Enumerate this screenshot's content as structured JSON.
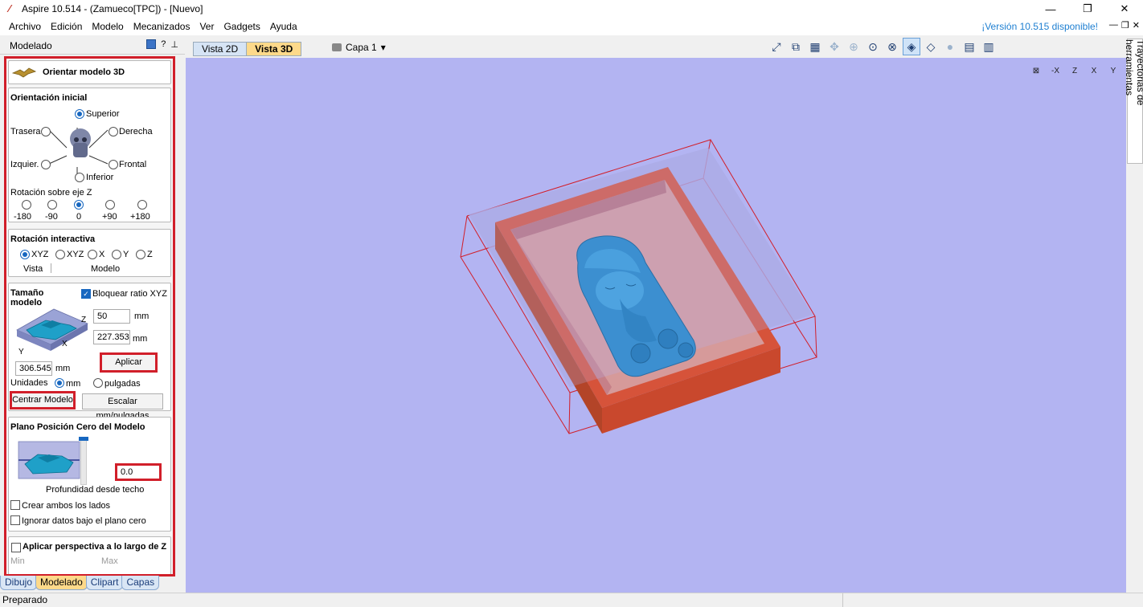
{
  "window": {
    "title": "Aspire 10.514 - (Zamueco[TPC]) - [Nuevo]"
  },
  "menu": {
    "items": [
      "Archivo",
      "Edición",
      "Modelo",
      "Mecanizados",
      "Ver",
      "Gadgets",
      "Ayuda"
    ],
    "version_link": "¡Versión 10.515 disponible!"
  },
  "left_header": {
    "title": "Modelado",
    "help": "?"
  },
  "panel": {
    "title": "Orientar modelo 3D",
    "orientation": {
      "title": "Orientación inicial",
      "superior": "Superior",
      "trasera": "Trasera",
      "derecha": "Derecha",
      "izquierda": "Izquier.",
      "frontal": "Frontal",
      "inferior": "Inferior",
      "selected": "Superior"
    },
    "rotation_z": {
      "label": "Rotación sobre eje Z",
      "options": [
        "-180",
        "-90",
        "0",
        "+90",
        "+180"
      ],
      "selected": "0"
    },
    "interactive": {
      "title": "Rotación interactiva",
      "options": [
        "XYZ",
        "XYZ",
        "X",
        "Y",
        "Z"
      ],
      "selected": 0,
      "group_vista": "Vista",
      "group_modelo": "Modelo"
    },
    "size": {
      "title": "Tamaño modelo",
      "lock_label": "Bloquear ratio XYZ",
      "lock_checked": true,
      "z_value": "50",
      "y_value": "227.353",
      "x_value": "306.545",
      "unit": "mm",
      "axis_z": "Z",
      "axis_x": "X",
      "axis_y": "Y",
      "apply_button": "Aplicar",
      "units_label": "Unidades",
      "unit_mm": "mm",
      "unit_in": "pulgadas",
      "center_button": "Centrar Modelo",
      "scale_button": "Escalar mm/pulgadas"
    },
    "zero_plane": {
      "title": "Plano Posición Cero del Modelo",
      "value": "0.0",
      "depth_label": "Profundidad desde techo",
      "both_sides": "Crear ambos los lados",
      "ignore_below": "Ignorar datos bajo el plano cero"
    },
    "perspective": {
      "title": "Aplicar perspectiva a lo largo de Z",
      "min": "Min",
      "max": "Max"
    }
  },
  "bottom_tabs": [
    {
      "label": "Dibujo"
    },
    {
      "label": "Modelado",
      "active": true
    },
    {
      "label": "Clipart"
    },
    {
      "label": "Capas"
    }
  ],
  "view_tabs": [
    {
      "label": "Vista 2D"
    },
    {
      "label": "Vista 3D",
      "active": true
    }
  ],
  "layer": {
    "label": "Capa 1",
    "arrow": "▾"
  },
  "right_tab": {
    "label": "Trayectorias de herramientas"
  },
  "status": {
    "text": "Preparado"
  },
  "axis_views": [
    "iso",
    "-X",
    "Z",
    "X",
    "Y"
  ],
  "colors": {
    "viewport_bg": "#b3b4f2",
    "panel_border": "#d11f2a",
    "material_block": "#d6533a",
    "model": "#3c8fd0",
    "bounding_box": "#d11f2a"
  }
}
